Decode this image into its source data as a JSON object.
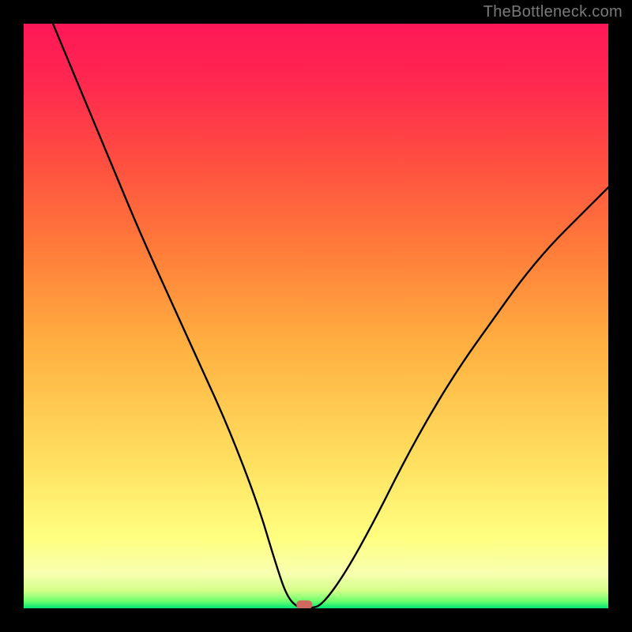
{
  "watermark": "TheBottleneck.com",
  "chart_data": {
    "type": "line",
    "title": "",
    "xlabel": "",
    "ylabel": "",
    "xlim": [
      0,
      100
    ],
    "ylim": [
      0,
      100
    ],
    "grid": false,
    "legend": false,
    "series": [
      {
        "name": "bottleneck-curve",
        "x": [
          5,
          10,
          15,
          20,
          25,
          30,
          35,
          40,
          43,
          45,
          47,
          49,
          51,
          55,
          60,
          65,
          70,
          75,
          80,
          85,
          90,
          95,
          100
        ],
        "y": [
          100,
          88,
          76,
          64,
          53,
          42,
          31,
          18,
          8,
          2,
          0,
          0,
          0.5,
          6,
          15,
          25,
          34,
          42,
          49,
          56,
          62,
          67,
          72
        ]
      }
    ],
    "annotations": [
      {
        "name": "bottleneck-point",
        "x": 48,
        "y": 0
      }
    ],
    "background": {
      "type": "vertical-gradient",
      "stops": [
        {
          "pos": 0.0,
          "color": "#00e676"
        },
        {
          "pos": 0.012,
          "color": "#6cff6c"
        },
        {
          "pos": 0.03,
          "color": "#d4ff8a"
        },
        {
          "pos": 0.06,
          "color": "#f8ffb0"
        },
        {
          "pos": 0.12,
          "color": "#ffff80"
        },
        {
          "pos": 0.25,
          "color": "#ffe060"
        },
        {
          "pos": 0.45,
          "color": "#ffb040"
        },
        {
          "pos": 0.62,
          "color": "#ff7a3a"
        },
        {
          "pos": 0.78,
          "color": "#ff4a42"
        },
        {
          "pos": 0.9,
          "color": "#ff2850"
        },
        {
          "pos": 1.0,
          "color": "#ff1757"
        }
      ]
    }
  }
}
